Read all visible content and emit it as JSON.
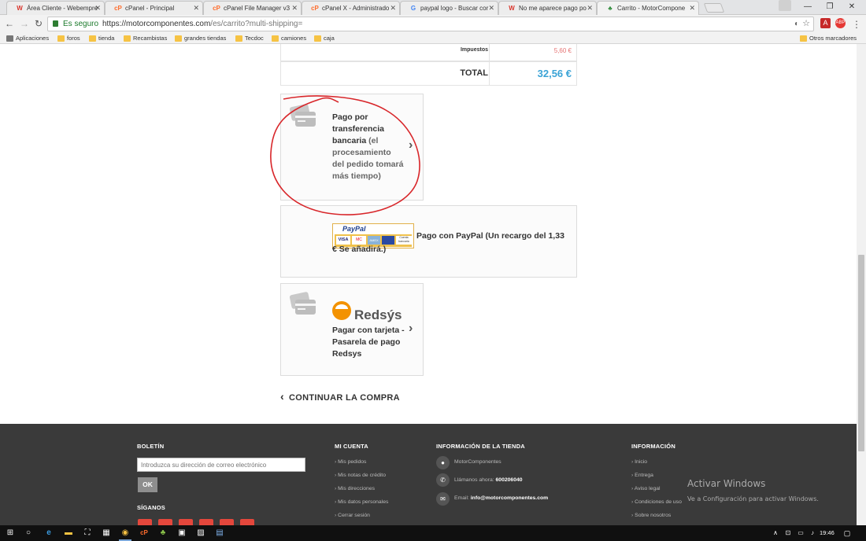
{
  "browser": {
    "tabs": [
      {
        "title": "Área Cliente - Webempre",
        "favicon": "W",
        "color": "#d9342b"
      },
      {
        "title": "cPanel - Principal",
        "favicon": "cP",
        "color": "#ff6c2c"
      },
      {
        "title": "cPanel File Manager v3",
        "favicon": "cP",
        "color": "#ff6c2c"
      },
      {
        "title": "cPanel X - Administrado",
        "favicon": "cP",
        "color": "#ff6c2c"
      },
      {
        "title": "paypal logo - Buscar cor",
        "favicon": "G",
        "color": "#4285f4"
      },
      {
        "title": "No me aparece pago po",
        "favicon": "W",
        "color": "#d9342b"
      },
      {
        "title": "Carrito - MotorCompone",
        "favicon": "♣",
        "color": "#2e8b3a"
      }
    ],
    "secure_label": "Es seguro",
    "url_host": "https://motorcomponentes.com",
    "url_path": "/es/carrito?multi-shipping=",
    "bookmarks": [
      "Aplicaciones",
      "foros",
      "tienda",
      "Recambistas",
      "grandes tiendas",
      "Tecdoc",
      "camiones",
      "caja"
    ],
    "other_bookmarks": "Otros marcadores"
  },
  "totals": {
    "tax_label": "Impuestos",
    "tax_value": "5,60 €",
    "total_label": "TOTAL",
    "total_value": "32,56 €"
  },
  "payments": {
    "bank": {
      "title": "Pago por transferencia bancaria",
      "note": "(el procesamiento del pedido tomará más tiempo)"
    },
    "paypal": {
      "logo": "PayPal",
      "cards": [
        "VISA",
        "MC",
        "AMEX",
        "Cuenta bancaria"
      ],
      "text": "Pago con PayPal (Un recargo del 1,33 € Se añadirá.)"
    },
    "redsys": {
      "logo": "Redsýs",
      "text": "Pagar con tarjeta - Pasarela de pago Redsys"
    }
  },
  "continue_label": "CONTINUAR LA COMPRA",
  "footer": {
    "newsletter": {
      "title": "BOLETÍN",
      "placeholder": "Introduzca su dirección de correo electrónico",
      "button": "OK"
    },
    "follow_title": "SÍGANOS",
    "account": {
      "title": "MI CUENTA",
      "items": [
        "Mis pedidos",
        "Mis notas de crédito",
        "Mis direcciones",
        "Mis datos personales",
        "Cerrar sesión"
      ]
    },
    "store": {
      "title": "INFORMACIÓN DE LA TIENDA",
      "name": "MotorComponentes",
      "phone_label": "Llámanos ahora:",
      "phone": "600206040",
      "email_label": "Email:",
      "email": "info@motorcomponentes.com"
    },
    "info": {
      "title": "INFORMACIÓN",
      "items": [
        "Inicio",
        "Entrega",
        "Aviso legal",
        "Condiciones de uso",
        "Sobre nosotros"
      ]
    }
  },
  "watermark": {
    "line1": "Activar Windows",
    "line2": "Ve a Configuración para activar Windows."
  },
  "taskbar": {
    "time": "19:46"
  }
}
